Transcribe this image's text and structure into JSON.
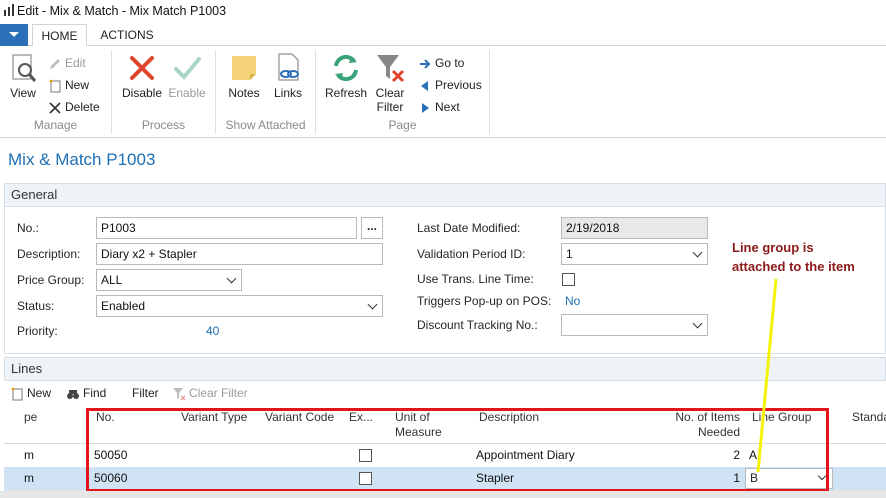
{
  "window": {
    "title": "Edit - Mix & Match - Mix  Match P1003"
  },
  "ribbon": {
    "tabs": [
      {
        "label": "HOME"
      },
      {
        "label": "ACTIONS"
      }
    ],
    "groups": {
      "manage": {
        "label": "Manage",
        "view": "View",
        "edit": "Edit",
        "new": "New",
        "delete": "Delete"
      },
      "process": {
        "label": "Process",
        "disable": "Disable",
        "enable": "Enable"
      },
      "show_attached": {
        "label": "Show Attached",
        "notes": "Notes",
        "links": "Links"
      },
      "page": {
        "label": "Page",
        "refresh": "Refresh",
        "clear_filter_1": "Clear",
        "clear_filter_2": "Filter",
        "go_to": "Go to",
        "previous": "Previous",
        "next": "Next"
      }
    }
  },
  "page": {
    "title": "Mix & Match P1003"
  },
  "general": {
    "header": "General",
    "fields": {
      "no": {
        "label": "No.:",
        "value": "P1003",
        "button": "..."
      },
      "description": {
        "label": "Description:",
        "value": "Diary x2 + Stapler"
      },
      "price_group": {
        "label": "Price Group:",
        "value": "ALL"
      },
      "status": {
        "label": "Status:",
        "value": "Enabled"
      },
      "priority": {
        "label": "Priority:",
        "value": "40"
      },
      "last_date_modified": {
        "label": "Last Date Modified:",
        "value": "2/19/2018"
      },
      "validation_period_id": {
        "label": "Validation Period ID:",
        "value": "1"
      },
      "use_trans_line_time": {
        "label": "Use Trans. Line Time:",
        "checked": false
      },
      "triggers_popup": {
        "label": "Triggers Pop-up on POS:",
        "value": "No"
      },
      "discount_tracking_no": {
        "label": "Discount Tracking No.:",
        "value": ""
      }
    }
  },
  "annotation": {
    "line1": "Line group is",
    "line2": "attached to the item",
    "color": "#8b1a1a",
    "box_color": "#e3141c",
    "arrow_color": "#f5f20a"
  },
  "lines": {
    "header": "Lines",
    "toolbar": {
      "new": "New",
      "find": "Find",
      "filter": "Filter",
      "clear_filter": "Clear Filter"
    },
    "columns": {
      "type": "pe",
      "no": "No.",
      "variant_type": "Variant Type",
      "variant_code": "Variant Code",
      "ex": "Ex...",
      "unit1": "Unit of",
      "unit2": "Measure",
      "description": "Description",
      "items1": "No. of Items",
      "items2": "Needed",
      "line_group": "Line Group",
      "standard": "Standa"
    },
    "rows": [
      {
        "type": "m",
        "no": "50050",
        "description": "Appointment Diary",
        "items_needed": "2",
        "line_group": "A"
      },
      {
        "type": "m",
        "no": "50060",
        "description": "Stapler",
        "items_needed": "1",
        "line_group": "B"
      }
    ]
  }
}
